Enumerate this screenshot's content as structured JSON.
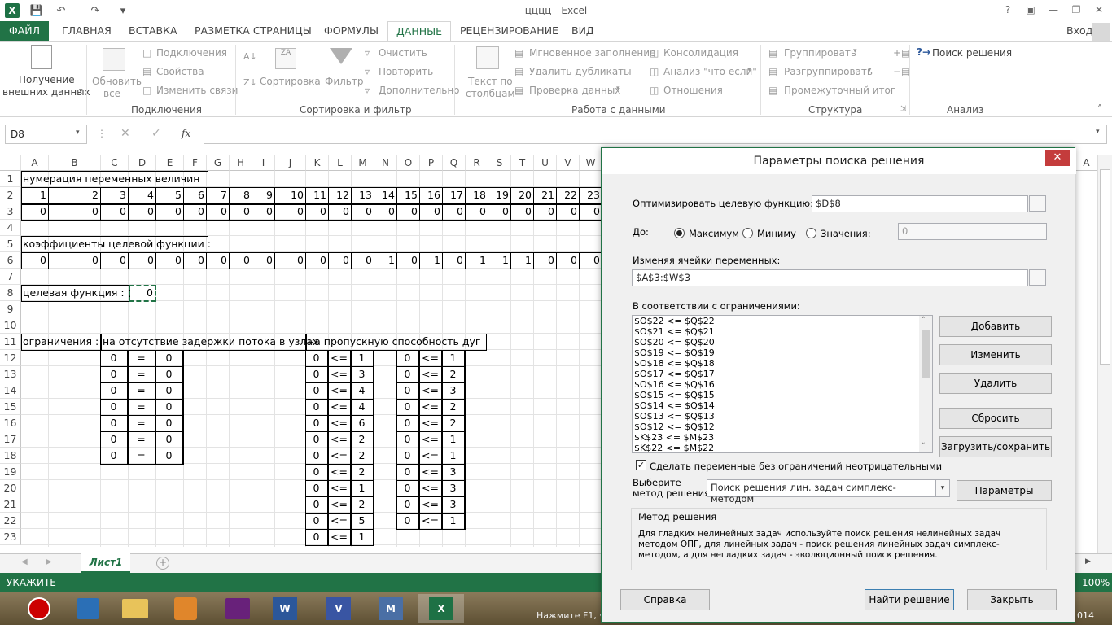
{
  "window": {
    "title": "цццц - Excel",
    "signin": "Вход"
  },
  "tabs": [
    "ФАЙЛ",
    "ГЛАВНАЯ",
    "ВСТАВКА",
    "РАЗМЕТКА СТРАНИЦЫ",
    "ФОРМУЛЫ",
    "ДАННЫЕ",
    "РЕЦЕНЗИРОВАНИЕ",
    "ВИД"
  ],
  "ribbon": {
    "get_external": [
      "Получение",
      "внешних данных"
    ],
    "refresh": [
      "Обновить",
      "все"
    ],
    "connections": "Подключения",
    "properties": "Свойства",
    "edit_links": "Изменить связи",
    "group_connections": "Подключения",
    "sort": "Сортировка",
    "filter": "Фильтр",
    "clear": "Очистить",
    "reapply": "Повторить",
    "advanced": "Дополнительно",
    "group_sort": "Сортировка и фильтр",
    "text_to_columns": [
      "Текст по",
      "столбцам"
    ],
    "flash_fill": "Мгновенное заполнение",
    "remove_dup": "Удалить дубликаты",
    "validation": "Проверка данных",
    "consolidate": "Консолидация",
    "whatif": "Анализ \"что если\"",
    "relations": "Отношения",
    "group_data_tools": "Работа с данными",
    "group": "Группировать",
    "ungroup": "Разгруппировать",
    "subtotal": "Промежуточный итог",
    "group_outline": "Структура",
    "solver": "Поиск решения",
    "group_analysis": "Анализ"
  },
  "formula": {
    "namebox": "D8",
    "content": ""
  },
  "columns": [
    "A",
    "B",
    "C",
    "D",
    "E",
    "F",
    "G",
    "H",
    "I",
    "J",
    "K",
    "L",
    "M",
    "N",
    "O",
    "P",
    "Q",
    "R",
    "S",
    "T",
    "U",
    "V",
    "W"
  ],
  "rows": [
    "1",
    "2",
    "3",
    "4",
    "5",
    "6",
    "7",
    "8",
    "9",
    "10",
    "11",
    "12",
    "13",
    "14",
    "15",
    "16",
    "17",
    "18",
    "19",
    "20",
    "21",
    "22",
    "23"
  ],
  "sheet": {
    "r1": "нумерация переменных величин",
    "r2": [
      "1",
      "2",
      "3",
      "4",
      "5",
      "6",
      "7",
      "8",
      "9",
      "10",
      "11",
      "12",
      "13",
      "14",
      "15",
      "16",
      "17",
      "18",
      "19",
      "20",
      "21",
      "22",
      "23"
    ],
    "r3": [
      "0",
      "0",
      "0",
      "0",
      "0",
      "0",
      "0",
      "0",
      "0",
      "0",
      "0",
      "0",
      "0",
      "0",
      "0",
      "0",
      "0",
      "0",
      "0",
      "0",
      "0",
      "0",
      "0"
    ],
    "r5": "коэффициенты целевой функции :",
    "r6": [
      "0",
      "0",
      "0",
      "0",
      "0",
      "0",
      "0",
      "0",
      "0",
      "0",
      "0",
      "0",
      "0",
      "1",
      "0",
      "1",
      "0",
      "1",
      "1",
      "1",
      "0",
      "0",
      "0"
    ],
    "r8_label": "целевая функция :",
    "r8_value": "0",
    "r11_a": "ограничения :",
    "r11_c": "на отсутствие задержки потока в узлах",
    "r11_k": "на пропускную способность дуг",
    "node": {
      "lhs": "0",
      "op": "=",
      "rhs": "0"
    },
    "arc1_op": "<=",
    "arc1": [
      "1",
      "3",
      "4",
      "4",
      "6",
      "2",
      "2",
      "2",
      "1",
      "2",
      "5",
      "1"
    ],
    "arc2": [
      "1",
      "2",
      "3",
      "2",
      "2",
      "1",
      "1",
      "3",
      "3",
      "3",
      "1"
    ],
    "zero": "0"
  },
  "sheet_tab": "Лист1",
  "status": {
    "mode": "УКАЖИТЕ",
    "zoom": "100%",
    "hint": "Нажмите F1, ч",
    "clock": "014"
  },
  "dialog": {
    "title": "Параметры поиска решения",
    "objective_label": "Оптимизировать целевую функцию:",
    "objective_value": "$D$8",
    "to_label": "До:",
    "opt_max": "Максимум",
    "opt_min": "Миниму",
    "opt_value": "Значения:",
    "value_input": "0",
    "vars_label": "Изменяя ячейки переменных:",
    "vars_value": "$A$3:$W$3",
    "constraints_label": "В соответствии с ограничениями:",
    "constraints": [
      "$O$22 <= $Q$22",
      "$O$21 <= $Q$21",
      "$O$20 <= $Q$20",
      "$O$19 <= $Q$19",
      "$O$18 <= $Q$18",
      "$O$17 <= $Q$17",
      "$O$16 <= $Q$16",
      "$O$15 <= $Q$15",
      "$O$14 <= $Q$14",
      "$O$13 <= $Q$13",
      "$O$12 <= $Q$12",
      "$K$23 <= $M$23",
      "$K$22 <= $M$22"
    ],
    "btn_add": "Добавить",
    "btn_change": "Изменить",
    "btn_delete": "Удалить",
    "btn_reset": "Сбросить",
    "btn_load": "Загрузить/сохранить",
    "nonneg": "Сделать переменные без ограничений неотрицательными",
    "method_label": [
      "Выберите",
      "метод решения:"
    ],
    "method_value": "Поиск решения лин. задач симплекс-методом",
    "btn_params": "Параметры",
    "method_group": "Метод решения",
    "method_desc": "Для гладких нелинейных задач используйте поиск решения нелинейных задач методом ОПГ, для линейных задач - поиск решения линейных задач симплекс-методом, а для негладких задач - эволюционный поиск решения.",
    "btn_help": "Справка",
    "btn_solve": "Найти решение",
    "btn_close": "Закрыть"
  }
}
